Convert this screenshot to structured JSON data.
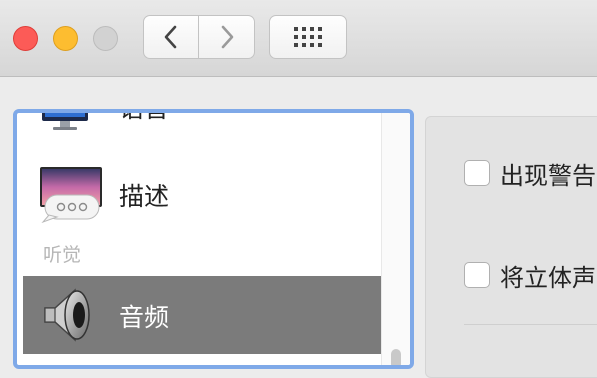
{
  "window": {
    "traffic_lights": [
      "close",
      "minimize",
      "zoom"
    ]
  },
  "toolbar": {
    "back_icon": "chevron-left-icon",
    "forward_icon": "chevron-right-icon",
    "show_all_icon": "grid-icon"
  },
  "sidebar": {
    "items": [
      {
        "label": "语音",
        "icon": "monitor-icon"
      },
      {
        "label": "描述",
        "icon": "description-speech-icon"
      },
      {
        "label": "音频",
        "icon": "speaker-icon",
        "selected": true
      }
    ],
    "section_hearing": "听觉"
  },
  "panel": {
    "options": [
      {
        "label": "出现警告",
        "checked": false
      },
      {
        "label": "将立体声",
        "checked": false
      }
    ]
  }
}
